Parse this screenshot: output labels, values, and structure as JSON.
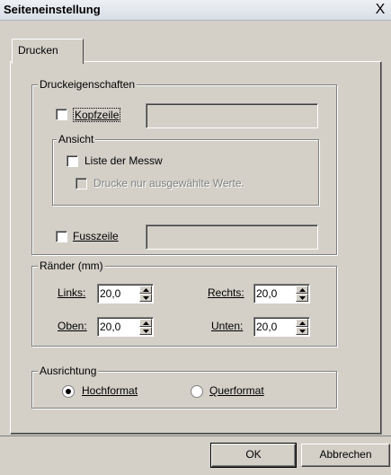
{
  "window": {
    "title": "Seiteneinstellung",
    "close_label": "X"
  },
  "tab": {
    "label": "Drucken"
  },
  "druck": {
    "legend": "Druckeigenschaften",
    "header": {
      "label": "Kopfzeile",
      "checked": false
    },
    "ansicht": {
      "legend": "Ansicht",
      "liste_label": "Liste der Messw",
      "selected_label": "Drucke nur ausgewählte Werte."
    },
    "footer": {
      "label": "Fusszeile",
      "checked": false
    }
  },
  "margins": {
    "legend": "Ränder (mm)",
    "links": {
      "label": "Links:",
      "value": "20,0"
    },
    "rechts": {
      "label": "Rechts:",
      "value": "20,0"
    },
    "oben": {
      "label": "Oben:",
      "value": "20,0"
    },
    "unten": {
      "label": "Unten:",
      "value": "20,0"
    }
  },
  "orientation": {
    "legend": "Ausrichtung",
    "portrait": {
      "label": "Hochformat",
      "selected": true
    },
    "landscape": {
      "label": "Querformat",
      "selected": false
    }
  },
  "buttons": {
    "ok": "OK",
    "cancel": "Abbrechen"
  }
}
